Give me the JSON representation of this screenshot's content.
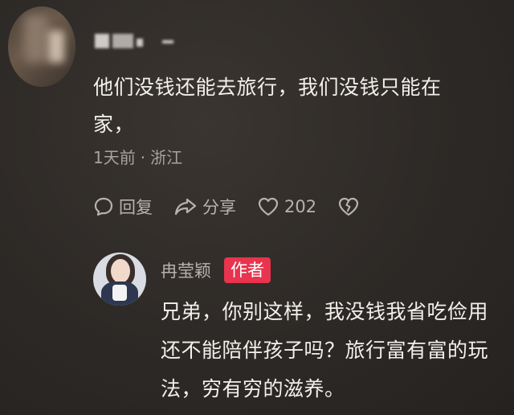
{
  "top_comment": {
    "text": "他们没钱还能去旅行，我们没钱只能在家，",
    "text_line1": "他们没钱还能去旅行，我们没钱只能在",
    "text_line2": "家，",
    "time": "1天前",
    "separator": "·",
    "location": "浙江",
    "actions": {
      "reply": "回复",
      "share": "分享",
      "likes": "202"
    }
  },
  "reply": {
    "username": "冉莹颖",
    "badge": "作者",
    "badge_color": "#e8344e",
    "text_line1": "兄弟，你别这样，我没钱我省吃俭用",
    "text_line2": "还不能陪伴孩子吗？旅行富有富的玩",
    "text_line3": "法，穷有穷的滋养。"
  },
  "icons": [
    "comment-icon",
    "share-icon",
    "heart-icon",
    "broken-heart-icon"
  ]
}
